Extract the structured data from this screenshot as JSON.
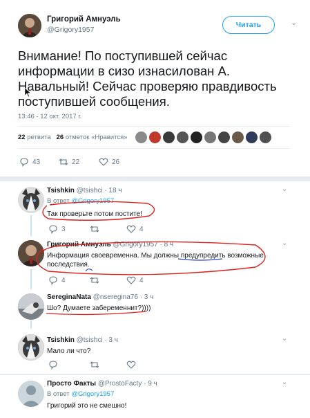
{
  "main_tweet": {
    "author_name": "Григорий Амнуэль",
    "author_handle": "@Grigory1957",
    "follow_label": "Читать",
    "text": "Внимание! По поступившей сейчас информации в сизо  изнасилован А. Навальный! Сейчас проверяю правдивость поступившей сообщения.",
    "timestamp": "13:46 - 12 окт. 2017 г.",
    "retweets_count": "22",
    "retweets_label": "ретвита",
    "likes_count": "26",
    "likes_label": "отметок «Нравится»",
    "actions": {
      "reply_count": "43",
      "retweet_count": "22",
      "like_count": "26"
    }
  },
  "replies": [
    {
      "name": "Tsishkin",
      "handle": "@tsishci",
      "time": "· 18 ч",
      "reply_to_prefix": "В ответ",
      "reply_to_handle": "@Grigory1957",
      "text": "Так проверьте потом постите!",
      "reply_count": "3",
      "retweet_count": "",
      "like_count": "4"
    },
    {
      "name": "Григорий Амнуэль",
      "handle": "@Grigory1957",
      "time": "· 8 ч",
      "text_line1": "Информация своевременна. Мы должны предупредить  возможные",
      "text_line2": "последствия.",
      "reply_count": "4",
      "retweet_count": "",
      "like_count": "4"
    },
    {
      "name": "SereginaNata",
      "handle": "@nseregina76",
      "time": "· 3 ч",
      "text": "Шо? Думаете забеременнит?))))",
      "reply_count": "",
      "retweet_count": "",
      "like_count": ""
    },
    {
      "name": "Tsishkin",
      "handle": "@tsishci",
      "time": "· 3 ч",
      "text": "Мало ли что?",
      "reply_count": "",
      "retweet_count": "",
      "like_count": ""
    },
    {
      "name": "Просто Факты",
      "handle": "@ProstoFacty",
      "time": "· 9 ч",
      "reply_to_prefix": "В ответ",
      "reply_to_handle": "@Grigory1957",
      "text": "Григорий это не смешно!"
    }
  ],
  "colors": {
    "accent": "#1da1f2",
    "muted": "#657786",
    "annotation": "#e0201c",
    "annotation_blue": "#2244cc"
  },
  "icons": [
    "reply-icon",
    "retweet-icon",
    "heart-icon",
    "chevron-down-icon",
    "cursor-icon"
  ]
}
